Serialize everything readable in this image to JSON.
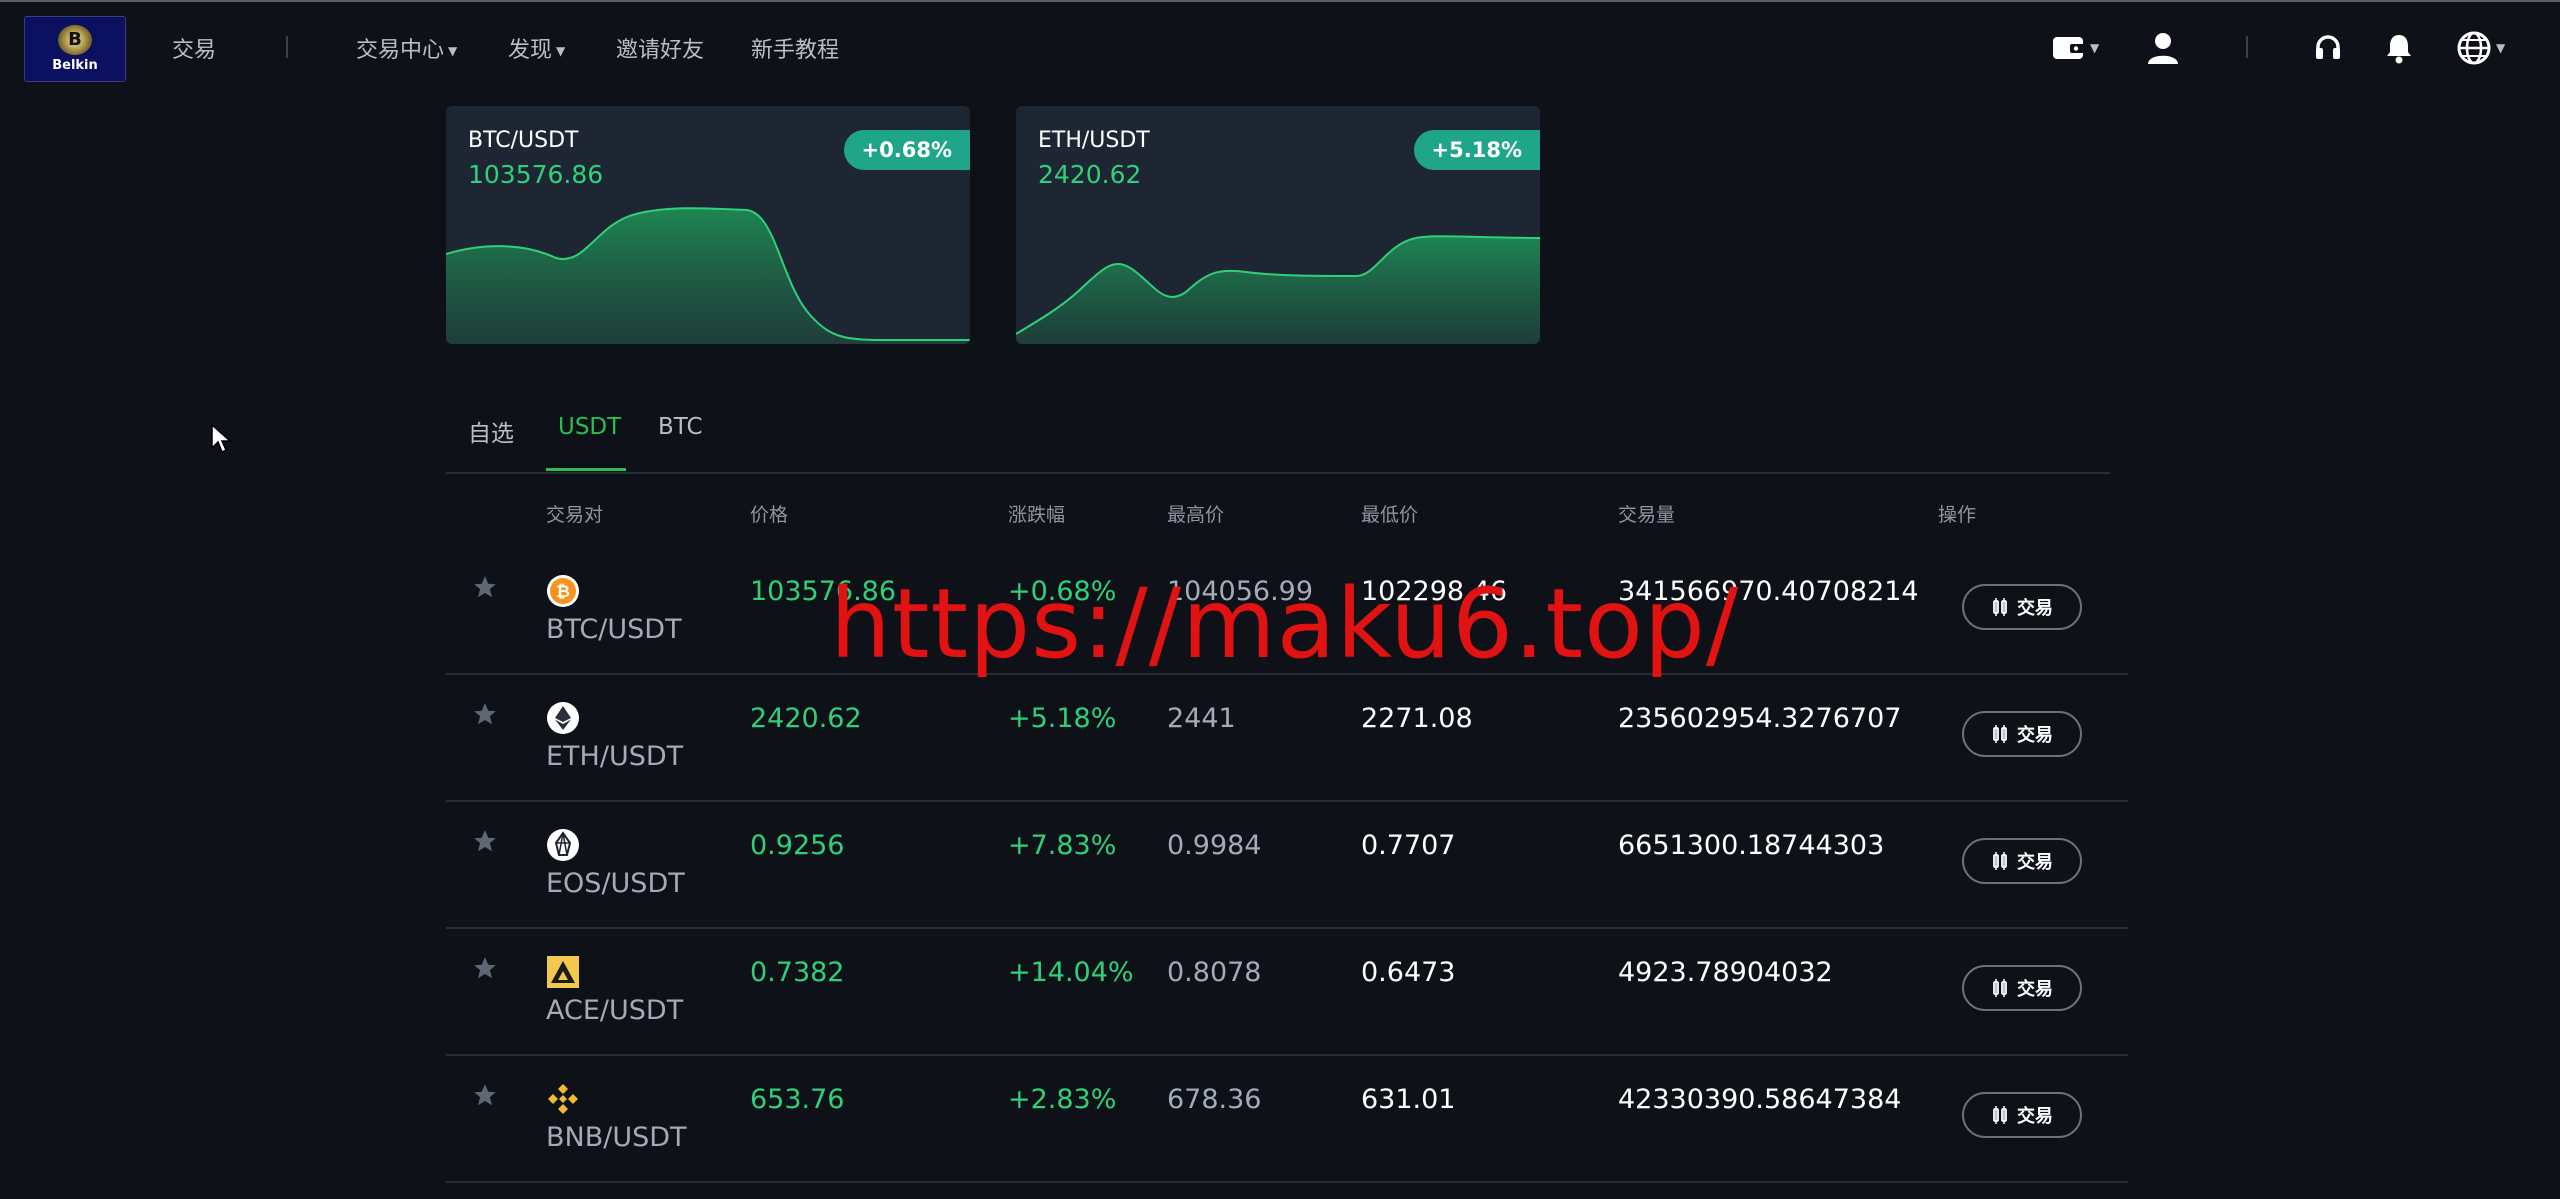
{
  "logo": {
    "text": "Belkin",
    "crest": "B"
  },
  "nav": {
    "trade": "交易",
    "trade_center": "交易中心",
    "discover": "发现",
    "invite": "邀请好友",
    "tutorial": "新手教程"
  },
  "icons": [
    "wallet-icon",
    "user-icon",
    "headset-icon",
    "bell-icon",
    "globe-icon"
  ],
  "cards": [
    {
      "pair": "BTC/USDT",
      "price": "103576.86",
      "change": "+0.68%"
    },
    {
      "pair": "ETH/USDT",
      "price": "2420.62",
      "change": "+5.18%"
    }
  ],
  "tabs": [
    "自选",
    "USDT",
    "BTC"
  ],
  "active_tab": "USDT",
  "table": {
    "headers": [
      "交易对",
      "价格",
      "涨跌幅",
      "最高价",
      "最低价",
      "交易量",
      "操作"
    ],
    "trade_label": "交易",
    "rows": [
      {
        "pair": "BTC/USDT",
        "price": "103576.86",
        "change": "+0.68%",
        "high": "104056.99",
        "low": "102298.46",
        "volume": "341566970.40708214"
      },
      {
        "pair": "ETH/USDT",
        "price": "2420.62",
        "change": "+5.18%",
        "high": "2441",
        "low": "2271.08",
        "volume": "235602954.3276707"
      },
      {
        "pair": "EOS/USDT",
        "price": "0.9256",
        "change": "+7.83%",
        "high": "0.9984",
        "low": "0.7707",
        "volume": "6651300.18744303"
      },
      {
        "pair": "ACE/USDT",
        "price": "0.7382",
        "change": "+14.04%",
        "high": "0.8078",
        "low": "0.6473",
        "volume": "4923.78904032"
      },
      {
        "pair": "BNB/USDT",
        "price": "653.76",
        "change": "+2.83%",
        "high": "678.36",
        "low": "631.01",
        "volume": "42330390.58647384"
      }
    ]
  },
  "watermark": "https://maku6.top/",
  "colors": {
    "up": "#2ed17a",
    "badge": "#1fa58a",
    "accent": "#2bbd52",
    "watermark": "#e01212"
  }
}
